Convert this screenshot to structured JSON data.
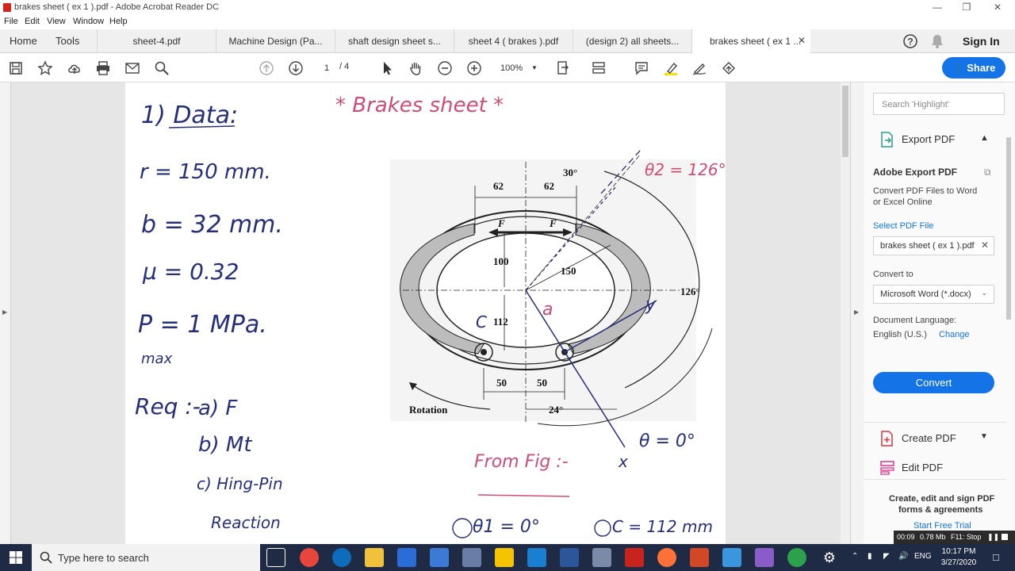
{
  "window": {
    "title": "brakes sheet ( ex 1 ).pdf - Adobe Acrobat Reader DC"
  },
  "menu": [
    "File",
    "Edit",
    "View",
    "Window",
    "Help"
  ],
  "nav_tabs": [
    "Home",
    "Tools"
  ],
  "doc_tabs": [
    "sheet-4.pdf",
    "Machine Design (Pa...",
    "shaft design sheet s...",
    "sheet 4 ( brakes ).pdf",
    "(design 2) all sheets...",
    "brakes sheet ( ex 1 ..."
  ],
  "account": {
    "signin": "Sign In"
  },
  "toolbar": {
    "page_current": "1",
    "page_total": "/ 4",
    "zoom": "100%",
    "share": "Share"
  },
  "right_panel": {
    "search_placeholder": "Search 'Highlight'",
    "export_header": "Export PDF",
    "adobe_export_title": "Adobe Export PDF",
    "adobe_export_desc_1": "Convert PDF Files to Word",
    "adobe_export_desc_2": "or Excel Online",
    "select_pdf_label": "Select PDF File",
    "selected_file": "brakes sheet ( ex 1 ).pdf",
    "convert_to_label": "Convert to",
    "convert_to_value": "Microsoft Word (*.docx)",
    "doc_language_label": "Document Language:",
    "doc_language_value": "English (U.S.)",
    "change_link": "Change",
    "convert_button": "Convert",
    "create_pdf": "Create PDF",
    "edit_pdf": "Edit PDF",
    "promo_1": "Create, edit and sign PDF",
    "promo_2": "forms & agreements",
    "promo_link": "Start Free Trial"
  },
  "document": {
    "heading": "1) Data:",
    "title": "* Brakes sheet *",
    "data_lines": [
      "r = 150 mm.",
      "b = 32 mm.",
      "μ = 0.32",
      "P = 1 MPa.",
      "max"
    ],
    "req_label": "Req :-",
    "req_items": [
      "a) F",
      "b) Mt",
      "c) Hing-Pin",
      "Reaction"
    ],
    "theta2": "θ2 = 126°",
    "theta_zero": "θ = 0°",
    "from_fig": "From Fig :-",
    "theta1": "θ1 = 0°",
    "c_value": "C = 112 mm",
    "diagram_labels": {
      "angle30": "30°",
      "dim62a": "62",
      "dim62b": "62",
      "forceF1": "F",
      "forceF2": "F",
      "dim100": "100",
      "dim150": "150",
      "angle126": "126°",
      "dim112": "112",
      "dim50a": "50",
      "dim50b": "50",
      "rotation": "Rotation",
      "angle24": "24°",
      "letterC": "C",
      "letterA": "a",
      "letterY": "y",
      "letterX": "x"
    }
  },
  "taskbar": {
    "search_placeholder": "Type here to search",
    "lang": "ENG",
    "time": "10:17 PM",
    "date": "3/27/2020"
  },
  "recorder": {
    "elapsed": "00:09",
    "size": "0.78 Mb",
    "stop": "F11: Stop"
  }
}
